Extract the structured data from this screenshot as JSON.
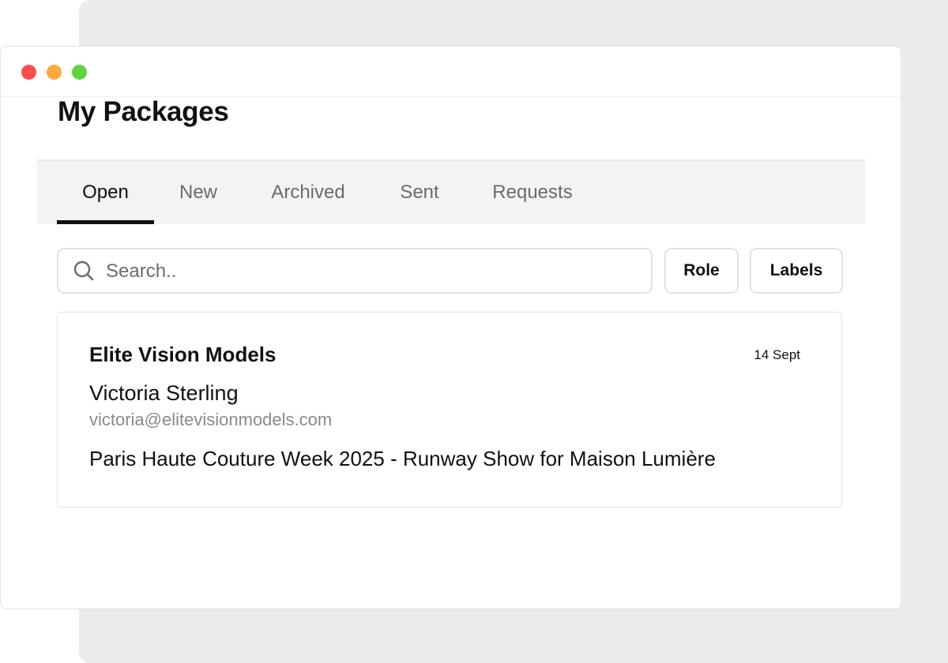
{
  "window": {
    "controls": {
      "close_color": "#fe4d4b",
      "minimize_color": "#fdaa3c",
      "maximize_color": "#5fd43a"
    }
  },
  "page": {
    "title": "My Packages"
  },
  "tabs": [
    {
      "label": "Open",
      "active": true
    },
    {
      "label": "New",
      "active": false
    },
    {
      "label": "Archived",
      "active": false
    },
    {
      "label": "Sent",
      "active": false
    },
    {
      "label": "Requests",
      "active": false
    }
  ],
  "search": {
    "placeholder": "Search..",
    "value": "",
    "icon": "search-icon"
  },
  "filters": {
    "role_label": "Role",
    "labels_label": "Labels"
  },
  "packages": [
    {
      "agency": "Elite Vision Models",
      "date": "14 Sept",
      "contact_name": "Victoria Sterling",
      "contact_email": "victoria@elitevisionmodels.com",
      "title": "Paris Haute Couture Week 2025 - Runway Show for Maison Lumière"
    }
  ]
}
